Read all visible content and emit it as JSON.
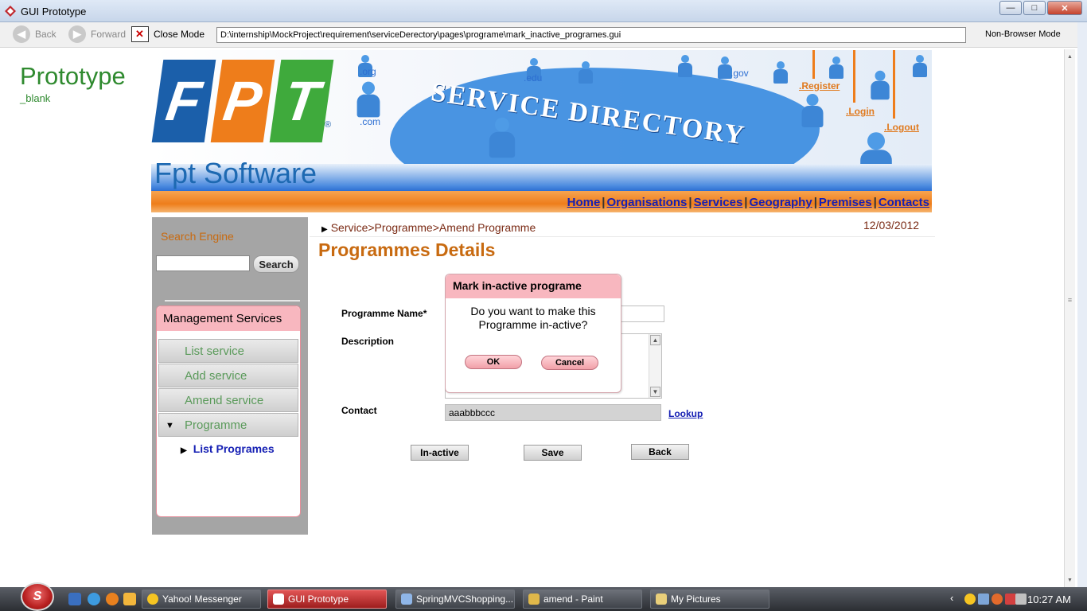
{
  "window": {
    "title": "GUI Prototype",
    "buttons": {
      "minimize": "—",
      "maximize": "□",
      "close": "✕"
    }
  },
  "toolbar": {
    "back": "Back",
    "forward": "Forward",
    "close_mode": "Close Mode",
    "address": "D:\\internship\\MockProject\\requirement\\serviceDerectory\\pages\\programe\\mark_inactive_programes.gui",
    "mode": "Non-Browser Mode"
  },
  "prototype": {
    "title": "Prototype",
    "subtitle": "_blank"
  },
  "banner": {
    "logo_letters": [
      "F",
      "P",
      "T"
    ],
    "registered": "®",
    "company": "Fpt Software",
    "headline": "SERVICE DIRECTORY",
    "domains": [
      ".org",
      ".edu",
      ".gov",
      ".com"
    ],
    "auth_links": {
      "register": ".Register",
      "login": ".Login",
      "logout": ".Logout"
    }
  },
  "nav": {
    "links": [
      "Home",
      "Organisations",
      "Services",
      "Geography",
      "Premises",
      "Contacts"
    ],
    "separator": "|"
  },
  "sidebar": {
    "search_label": "Search Engine",
    "search_value": "",
    "search_button": "Search",
    "management_title": "Management Services",
    "items": [
      {
        "label": "List service"
      },
      {
        "label": "Add service"
      },
      {
        "label": "Amend service"
      },
      {
        "label": "Programme",
        "expanded": true
      }
    ],
    "sub_item": "List Programes"
  },
  "main": {
    "breadcrumb": "Service>Programme>Amend Programme",
    "date": "12/03/2012",
    "page_title": "Programmes Details",
    "fields": {
      "programme_name_label": "Programme Name*",
      "programme_name_value": "",
      "description_label": "Description",
      "description_value": "",
      "contact_label": "Contact",
      "contact_value": "aaabbbccc",
      "lookup": "Lookup"
    },
    "buttons": {
      "inactive": "In-active",
      "save": "Save",
      "back": "Back"
    }
  },
  "dialog": {
    "title": "Mark in-active programe",
    "message": "Do you want to make this Programme in-active?",
    "ok": "OK",
    "cancel": "Cancel"
  },
  "taskbar": {
    "tasks": [
      {
        "label": "Yahoo! Messenger",
        "active": false
      },
      {
        "label": "GUI Prototype",
        "active": true
      },
      {
        "label": "SpringMVCShopping...",
        "active": false
      },
      {
        "label": "amend - Paint",
        "active": false
      },
      {
        "label": "My Pictures",
        "active": false
      }
    ],
    "clock": "10:27 AM"
  },
  "colors": {
    "accent_orange": "#ee7d1b",
    "link_blue": "#1620b4",
    "prototype_green": "#2f8a2f",
    "dialog_pink": "#f8b7bf",
    "title_orange": "#c86a10"
  }
}
